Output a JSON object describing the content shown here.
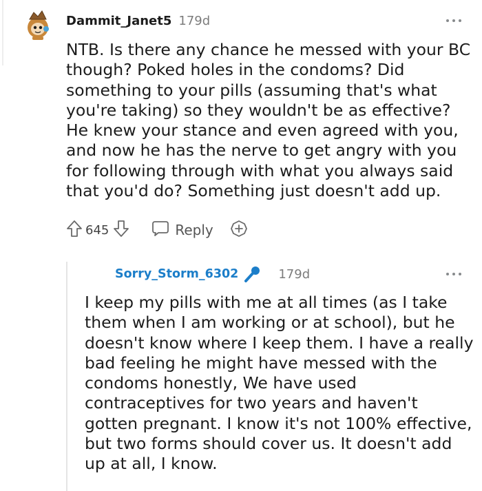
{
  "comment": {
    "username": "Dammit_Janet5",
    "age": "179d",
    "body": "NTB. Is there any chance he messed with your BC\nthough? Poked holes in the condoms? Did\nsomething to your pills (assuming that's what\nyou're taking) so they wouldn't be as effective?\nHe knew your stance and even agreed with you,\nand now he has the nerve to get angry with you\nfor following through with what you always said\nthat you'd do? Something just doesn't add up.",
    "vote_count": "645",
    "reply_label": "Reply",
    "icons": {
      "avatar": "snoo-avatar",
      "more": "more-options-icon",
      "upvote": "upvote-arrow-icon",
      "downvote": "downvote-arrow-icon",
      "reply": "reply-chat-icon",
      "award": "award-plus-icon"
    }
  },
  "reply": {
    "username": "Sorry_Storm_6302",
    "age": "179d",
    "body": "I keep my pills with me at all times (as I take\nthem when I am working or at school), but he\ndoesn't know where I keep them. I have a really\nbad feeling he might have messed with the\ncondoms honestly, We have used\ncontraceptives for two years and haven't\ngotten pregnant. I know it's not 100% effective,\nbut two forms should cover us. It doesn't add\nup at all, I know.",
    "icons": {
      "op_badge": "microphone-icon",
      "more": "more-options-icon"
    }
  },
  "colors": {
    "text": "#1c1c1c",
    "muted": "#7c7c7c",
    "op_blue": "#1c7ec9",
    "icon_gray": "#878a8c"
  }
}
